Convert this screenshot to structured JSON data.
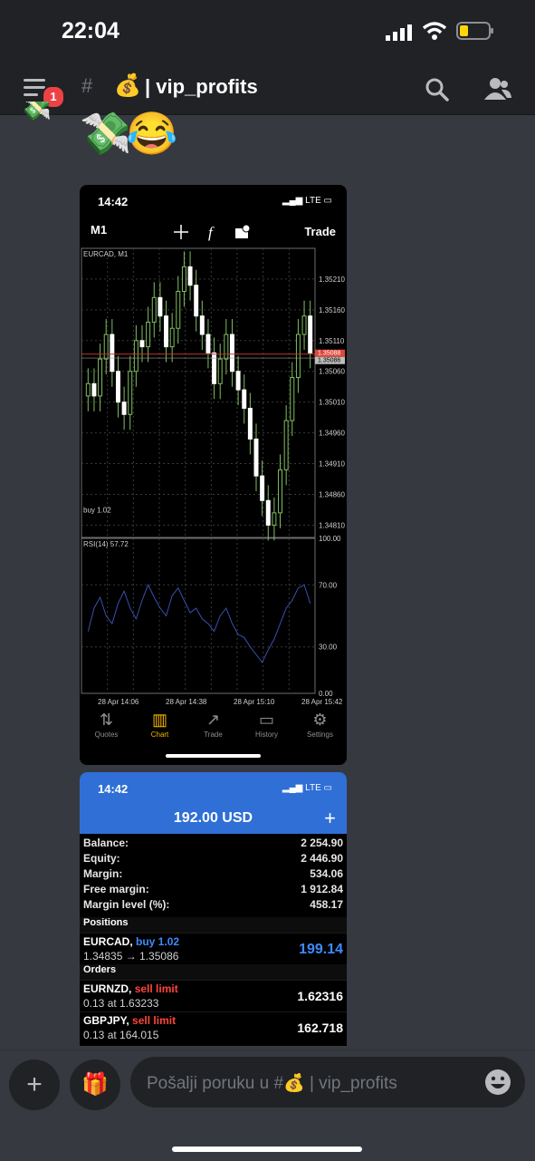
{
  "status": {
    "time": "22:04"
  },
  "header": {
    "channel_emoji": "💰",
    "channel_name": "| vip_profits",
    "badge": "1"
  },
  "message": {
    "emojis": "💸😂"
  },
  "screenshot1": {
    "time": "14:42",
    "network": "LTE",
    "timeframe": "M1",
    "trade_label": "Trade",
    "chart_title": "EURCAD, M1",
    "buy_label": "buy 1.02",
    "rsi_label": "RSI(14) 57.72",
    "price_ticks": [
      "1.35210",
      "1.35160",
      "1.35110",
      "1.35060",
      "1.35010",
      "1.34960",
      "1.34910",
      "1.34860",
      "1.34810"
    ],
    "price_tag_1": "1.35088",
    "price_tag_2": "1.35086",
    "rsi_ticks": [
      "100.00",
      "70.00",
      "30.00",
      "0.00"
    ],
    "time_ticks": [
      "28 Apr 14:06",
      "28 Apr 14:38",
      "28 Apr 15:10",
      "28 Apr 15:42"
    ],
    "tabs": [
      "Quotes",
      "Chart",
      "Trade",
      "History",
      "Settings"
    ]
  },
  "screenshot2": {
    "time": "14:42",
    "network": "LTE",
    "total": "192.00 USD",
    "account": [
      {
        "k": "Balance:",
        "v": "2 254.90"
      },
      {
        "k": "Equity:",
        "v": "2 446.90"
      },
      {
        "k": "Margin:",
        "v": "534.06"
      },
      {
        "k": "Free margin:",
        "v": "1 912.84"
      },
      {
        "k": "Margin level (%):",
        "v": "458.17"
      }
    ],
    "positions_label": "Positions",
    "orders_label": "Orders",
    "positions": [
      {
        "symbol": "EURCAD,",
        "side": "buy 1.02",
        "detail": "1.34835 → 1.35086",
        "amount": "199.14"
      }
    ],
    "orders": [
      {
        "symbol": "EURNZD,",
        "side": "sell limit",
        "detail": "0.13 at 1.63233",
        "amount": "1.62316"
      },
      {
        "symbol": "GBPJPY,",
        "side": "sell limit",
        "detail": "0.13 at 164.015",
        "amount": "162.718"
      }
    ]
  },
  "input": {
    "placeholder": "Pošalji poruku u #💰 | vip_profits"
  },
  "chart_data": {
    "type": "candlestick",
    "title": "EURCAD, M1",
    "closes": [
      1.3504,
      1.3502,
      1.3508,
      1.3512,
      1.3506,
      1.3501,
      1.3499,
      1.3506,
      1.3511,
      1.351,
      1.3514,
      1.3518,
      1.3515,
      1.351,
      1.3513,
      1.3519,
      1.3523,
      1.352,
      1.3515,
      1.3512,
      1.3509,
      1.3504,
      1.3508,
      1.3512,
      1.3506,
      1.3503,
      1.35,
      1.3495,
      1.3489,
      1.3485,
      1.3481,
      1.3483,
      1.349,
      1.3498,
      1.3505,
      1.3512,
      1.3515,
      1.3509
    ],
    "ylim": [
      1.3479,
      1.3526
    ],
    "rsi": [
      40,
      55,
      62,
      50,
      45,
      58,
      66,
      55,
      48,
      60,
      70,
      62,
      55,
      50,
      63,
      68,
      60,
      52,
      55,
      48,
      45,
      40,
      50,
      55,
      45,
      38,
      36,
      30,
      25,
      20,
      28,
      35,
      45,
      55,
      60,
      68,
      70,
      58
    ],
    "rsi_ylim": [
      0,
      100
    ]
  }
}
